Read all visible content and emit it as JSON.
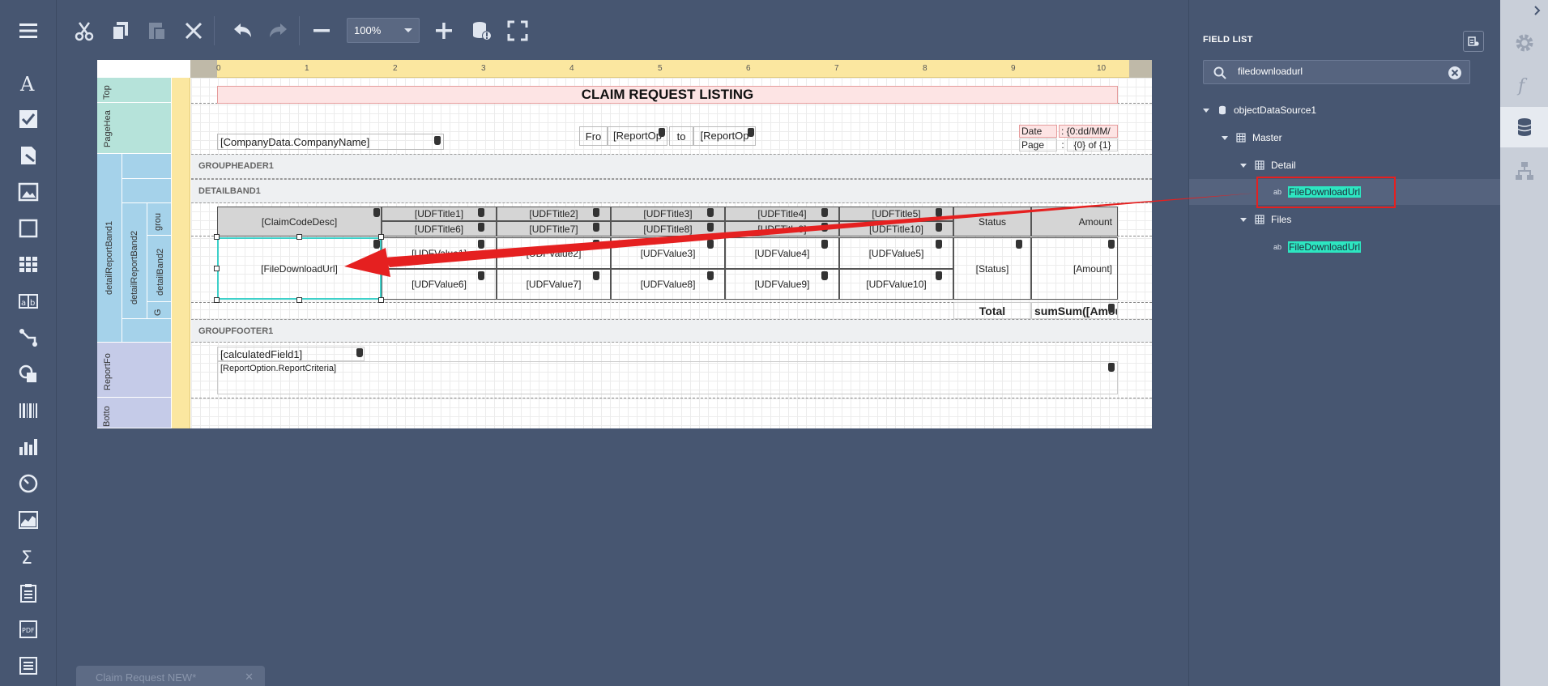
{
  "toolbar": {
    "zoom": "100%",
    "buttons": [
      "menu-icon",
      "cut-icon",
      "copy-icon",
      "paste-icon",
      "delete-icon",
      "undo-icon",
      "redo-icon",
      "zoom-out-icon",
      "zoom-in-icon",
      "validate-bindings-icon",
      "fullscreen-icon"
    ]
  },
  "toolbox": [
    "label",
    "checkbox",
    "rich-text",
    "picture",
    "panel",
    "table",
    "character-comb",
    "line",
    "shape",
    "barcode",
    "chart",
    "gauge",
    "sparkline",
    "page-info",
    "table-of-contents",
    "pdf-content",
    "pivot-grid"
  ],
  "ruler": [
    "0",
    "1",
    "2",
    "3",
    "4",
    "5",
    "6",
    "7",
    "8",
    "9",
    "10"
  ],
  "bands": {
    "top": "Top",
    "page_header": "PageHea",
    "detail_report_band1": "detailReportBand1",
    "detail_report_band2": "detailReportBand2",
    "detail_band2": "detailBand2",
    "group": "grou",
    "group_footer_short": "G",
    "report_footer": "ReportFo",
    "bottom": "Botto",
    "groupheader1": "GROUPHEADER1",
    "detailband1": "DETAILBAND1",
    "groupfooter1": "GROUPFOOTER1"
  },
  "report": {
    "title": "CLAIM REQUEST LISTING",
    "company": "[CompanyData.CompanyName]",
    "from": "Fro",
    "date_from": "[ReportOp",
    "to": "to",
    "date_to": "[ReportOp",
    "date_label": "Date",
    "date_value": ": {0:dd/MM/",
    "page_label": "Page",
    "page_colon": ":",
    "page_value": "{0} of {1}",
    "claim_code": "[ClaimCodeDesc]",
    "file_download": "[FileDownloadUrl]",
    "udf_titles": [
      "[UDFTitle1]",
      "[UDFTitle2]",
      "[UDFTitle3]",
      "[UDFTitle4]",
      "[UDFTitle5]"
    ],
    "udf_titles2": [
      "[UDFTitle6]",
      "[UDFTitle7]",
      "[UDFTitle8]",
      "[UDFTitle9]",
      "[UDFTitle10]"
    ],
    "udf_values": [
      "[UDFValue1]",
      "[UDFValue2]",
      "[UDFValue3]",
      "[UDFValue4]",
      "[UDFValue5]"
    ],
    "udf_values2": [
      "[UDFValue6]",
      "[UDFValue7]",
      "[UDFValue8]",
      "[UDFValue9]",
      "[UDFValue10]"
    ],
    "status_header": "Status",
    "amount_header": "Amount",
    "status_value": "[Status]",
    "amount_value": "[Amount]",
    "total_label": "Total",
    "total_value": "sumSum([Amoun",
    "calculated": "[calculatedField1]",
    "criteria": "[ReportOption.ReportCriteria]"
  },
  "field_list": {
    "title": "FIELD LIST",
    "search_value": "filedownloadurl",
    "tree": {
      "root": "objectDataSource1",
      "master": "Master",
      "detail": "Detail",
      "detail_field": "FileDownloadUrl",
      "files": "Files",
      "files_field": "FileDownloadUrl"
    }
  },
  "tab": {
    "label": "Claim Request NEW*"
  },
  "colors": {
    "highlight": "#2de6c1",
    "annotation": "#e52020",
    "title_bg": "#fde4e4"
  }
}
